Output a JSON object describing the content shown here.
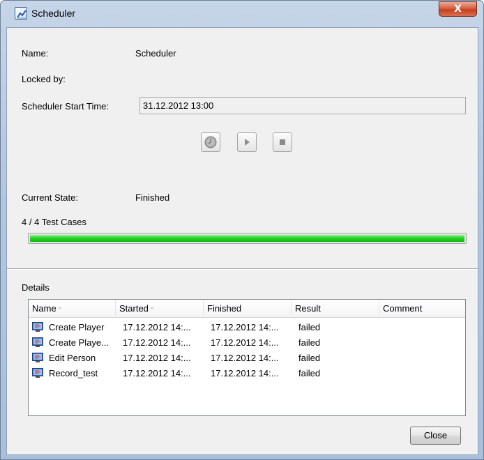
{
  "window": {
    "title": "Scheduler",
    "close_glyph": "X",
    "icon": "scheduler-app-icon"
  },
  "info": {
    "name_label": "Name:",
    "name_value": "Scheduler",
    "locked_label": "Locked by:",
    "locked_value": "",
    "start_time_label": "Scheduler Start Time:",
    "start_time_value": "31.12.2012 13:00"
  },
  "controls": {
    "schedule_icon": "clock-icon",
    "play_icon": "play-icon",
    "stop_icon": "stop-icon"
  },
  "state": {
    "label": "Current State:",
    "value": "Finished",
    "progress_text": "4 / 4 Test Cases",
    "progress_fraction": 1.0,
    "progress_color": "#1ec81e"
  },
  "details": {
    "heading": "Details",
    "columns": [
      "Name",
      "Started",
      "Finished",
      "Result",
      "Comment"
    ],
    "sort_indicator": "‴",
    "rows": [
      {
        "name": "Create Player",
        "started": "17.12.2012 14:...",
        "finished": "17.12.2012 14:...",
        "result": "failed",
        "comment": ""
      },
      {
        "name": "Create Playe...",
        "started": "17.12.2012 14:...",
        "finished": "17.12.2012 14:...",
        "result": "failed",
        "comment": ""
      },
      {
        "name": "Edit Person",
        "started": "17.12.2012 14:...",
        "finished": "17.12.2012 14:...",
        "result": "failed",
        "comment": ""
      },
      {
        "name": "Record_test",
        "started": "17.12.2012 14:...",
        "finished": "17.12.2012 14:...",
        "result": "failed",
        "comment": ""
      }
    ],
    "row_icon": "test-case-icon"
  },
  "footer": {
    "close_label": "Close"
  }
}
